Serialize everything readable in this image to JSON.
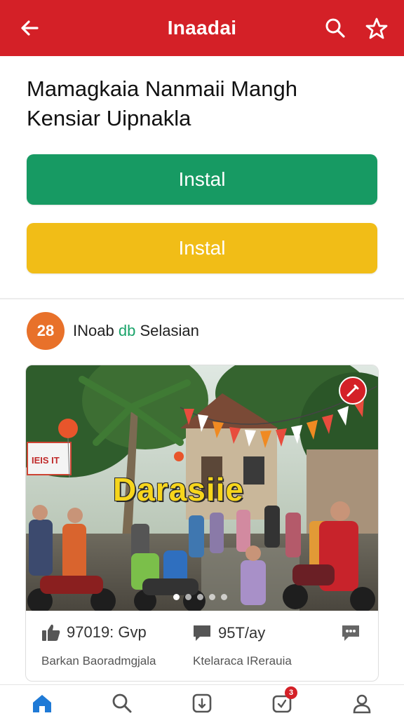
{
  "header": {
    "title": "Inaadai",
    "back_icon": "arrow-left-icon",
    "search_icon": "search-icon",
    "favorite_icon": "star-icon",
    "background_color": "#d42027"
  },
  "main": {
    "heading_line1": "Mamagkaia Nanmaii Mangh",
    "heading_line2": "Kensiar Uipnakla",
    "primary_button_label": "Instal",
    "secondary_button_label": "Instal",
    "primary_button_color": "#179a63",
    "secondary_button_color": "#f1bd17"
  },
  "post": {
    "avatar_text": "28",
    "author_prefix": "INoab",
    "author_accent": "db",
    "author_suffix": "Selasian",
    "overlay_text": "Darasiie",
    "carousel_count": 5,
    "carousel_active": 0,
    "likes_text": "97019: Gvp",
    "comments_text": "95T/ay",
    "caption_left": "Barkan Baoradmgjala",
    "caption_right": "Ktelaraca IRerauia"
  },
  "bottom_nav": {
    "items": [
      "home-icon",
      "search-icon",
      "add-post-icon",
      "notifications-icon",
      "profile-icon"
    ],
    "notification_badge": "3"
  }
}
